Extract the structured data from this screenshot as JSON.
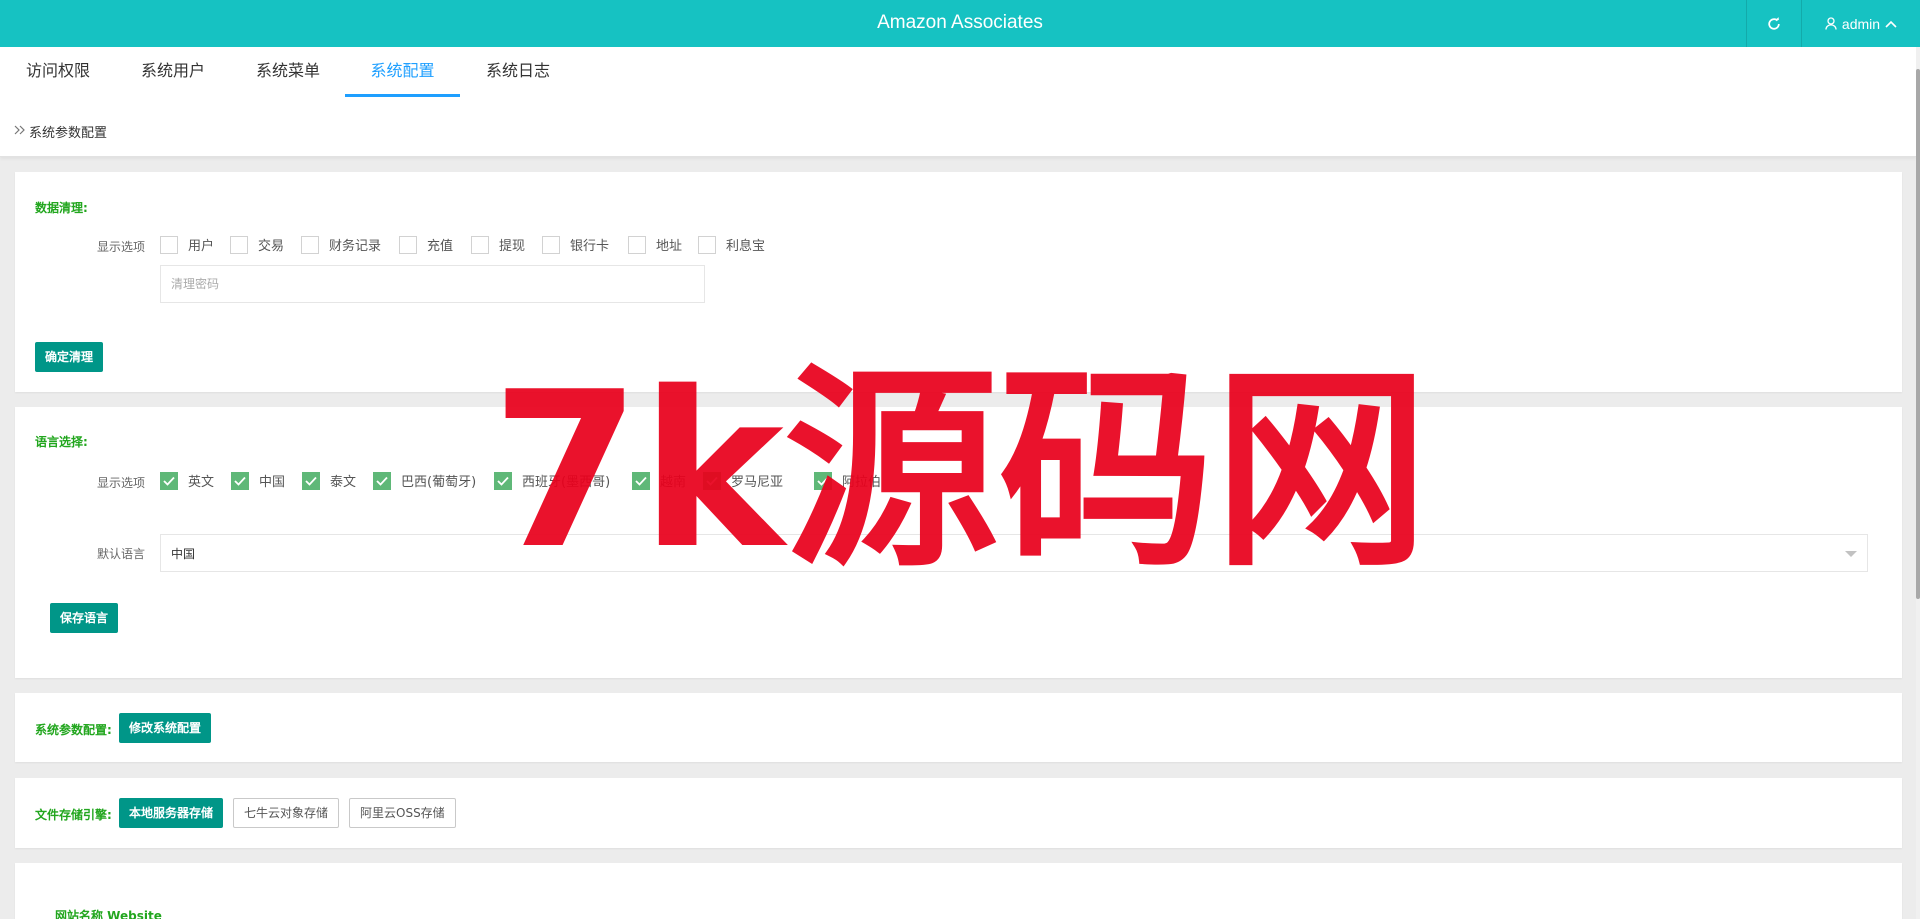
{
  "header": {
    "title": "Amazon Associates",
    "user": "admin",
    "bg_color": "#16c2c2"
  },
  "tabs": [
    {
      "label": "访问权限"
    },
    {
      "label": "系统用户"
    },
    {
      "label": "系统菜单"
    },
    {
      "label": "系统配置",
      "active": true
    },
    {
      "label": "系统日志"
    }
  ],
  "breadcrumb": "系统参数配置",
  "data_cleanup": {
    "title": "数据清理:",
    "options_label": "显示选项",
    "options": [
      {
        "label": "用户",
        "checked": false
      },
      {
        "label": "交易",
        "checked": false
      },
      {
        "label": "财务记录",
        "checked": false
      },
      {
        "label": "充值",
        "checked": false
      },
      {
        "label": "提现",
        "checked": false
      },
      {
        "label": "银行卡",
        "checked": false
      },
      {
        "label": "地址",
        "checked": false
      },
      {
        "label": "利息宝",
        "checked": false
      }
    ],
    "password_placeholder": "清理密码",
    "confirm_button": "确定清理"
  },
  "language": {
    "title": "语言选择:",
    "options_label": "显示选项",
    "options": [
      {
        "label": "英文",
        "checked": true
      },
      {
        "label": "中国",
        "checked": true
      },
      {
        "label": "泰文",
        "checked": true
      },
      {
        "label": "巴西(葡萄牙)",
        "checked": true
      },
      {
        "label": "西班牙(墨西哥)",
        "checked": true
      },
      {
        "label": "越南",
        "checked": true
      },
      {
        "label": "罗马尼亚",
        "checked": true
      },
      {
        "label": "阿拉伯",
        "checked": true
      }
    ],
    "default_label": "默认语言",
    "default_value": "中国",
    "save_button": "保存语言"
  },
  "sys_params": {
    "title": "系统参数配置:",
    "edit_button": "修改系统配置"
  },
  "storage": {
    "title": "文件存储引擎:",
    "buttons": [
      {
        "label": "本地服务器存储",
        "active": true
      },
      {
        "label": "七牛云对象存储",
        "active": false
      },
      {
        "label": "阿里云OSS存储",
        "active": false
      }
    ]
  },
  "website": {
    "title": "网站名称 Website"
  },
  "watermark": "7k源码网",
  "colors": {
    "accent_green": "#009688",
    "title_green": "#22a61e",
    "check_green": "#5fb878",
    "tab_active": "#1e9fff",
    "watermark_red": "#e8001c"
  }
}
